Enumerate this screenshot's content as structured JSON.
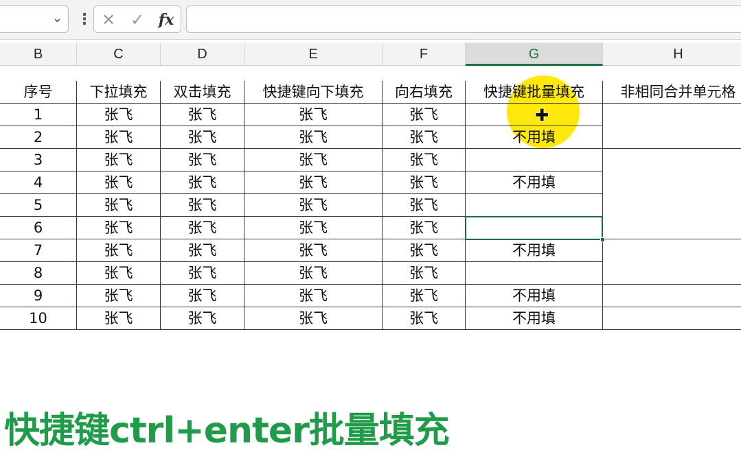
{
  "formula_bar": {
    "name_box_value": "",
    "name_box_chevron": "⌄",
    "separator": "⋮",
    "cancel_glyph": "✕",
    "confirm_glyph": "✓",
    "fx_label": "fx",
    "formula_value": ""
  },
  "columns": [
    "B",
    "C",
    "D",
    "E",
    "F",
    "G",
    "H"
  ],
  "selected_column": "G",
  "table": {
    "headers": [
      "序号",
      "下拉填充",
      "双击填充",
      "快捷键向下填充",
      "向右填充",
      "快捷键批量填充",
      "非相同合并单元格"
    ],
    "rows": [
      [
        "1",
        "张飞",
        "张飞",
        "张飞",
        "张飞",
        ""
      ],
      [
        "2",
        "张飞",
        "张飞",
        "张飞",
        "张飞",
        "不用填"
      ],
      [
        "3",
        "张飞",
        "张飞",
        "张飞",
        "张飞",
        ""
      ],
      [
        "4",
        "张飞",
        "张飞",
        "张飞",
        "张飞",
        "不用填"
      ],
      [
        "5",
        "张飞",
        "张飞",
        "张飞",
        "张飞",
        ""
      ],
      [
        "6",
        "张飞",
        "张飞",
        "张飞",
        "张飞",
        ""
      ],
      [
        "7",
        "张飞",
        "张飞",
        "张飞",
        "张飞",
        "不用填"
      ],
      [
        "8",
        "张飞",
        "张飞",
        "张飞",
        "张飞",
        ""
      ],
      [
        "9",
        "张飞",
        "张飞",
        "张飞",
        "张飞",
        "不用填"
      ],
      [
        "10",
        "张飞",
        "张飞",
        "张飞",
        "张飞",
        "不用填"
      ]
    ]
  },
  "cursor_glyph": "✚",
  "caption": "快捷键ctrl+enter批量填充",
  "colors": {
    "accent_green": "#1d6e3f",
    "caption_green": "#1f9b4a",
    "highlight_yellow": "#ffe800"
  }
}
